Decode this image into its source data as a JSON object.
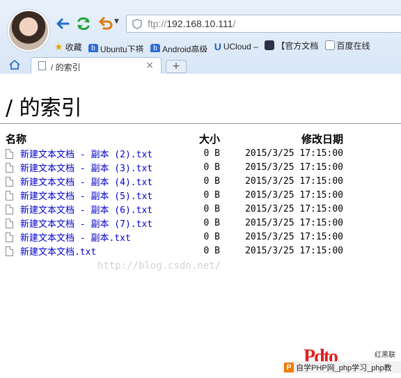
{
  "browser": {
    "url_prefix": "ftp://",
    "url_host": "192.168.10.111",
    "url_suffix": "/",
    "bookmarks": [
      {
        "label": "收藏",
        "icon": "star-icon"
      },
      {
        "label": "Ubuntu下搭",
        "icon": "ubuntu-icon"
      },
      {
        "label": "Android高级",
        "icon": "android-icon"
      },
      {
        "label": "UCloud –",
        "icon": "ucloud-icon"
      },
      {
        "label": "【官方文档",
        "icon": "site-icon"
      },
      {
        "label": "百度在线",
        "icon": "page-icon"
      }
    ],
    "tab_label": "/ 的索引",
    "tab_close": "×",
    "newtab_label": "+"
  },
  "page": {
    "heading": "/ 的索引",
    "columns": {
      "name": "名称",
      "size": "大小",
      "date": "修改日期"
    },
    "files": [
      {
        "name": "新建文本文档 - 副本 (2).txt",
        "size": "0 B",
        "date": "2015/3/25 17:15:00"
      },
      {
        "name": "新建文本文档 - 副本 (3).txt",
        "size": "0 B",
        "date": "2015/3/25 17:15:00"
      },
      {
        "name": "新建文本文档 - 副本 (4).txt",
        "size": "0 B",
        "date": "2015/3/25 17:15:00"
      },
      {
        "name": "新建文本文档 - 副本 (5).txt",
        "size": "0 B",
        "date": "2015/3/25 17:15:00"
      },
      {
        "name": "新建文本文档 - 副本 (6).txt",
        "size": "0 B",
        "date": "2015/3/25 17:15:00"
      },
      {
        "name": "新建文本文档 - 副本 (7).txt",
        "size": "0 B",
        "date": "2015/3/25 17:15:00"
      },
      {
        "name": "新建文本文档 - 副本.txt",
        "size": "0 B",
        "date": "2015/3/25 17:15:00"
      },
      {
        "name": "新建文本文档.txt",
        "size": "0 B",
        "date": "2015/3/25 17:15:00"
      }
    ],
    "watermark": "http://blog.csdn.net/"
  },
  "logo": {
    "glyph": "Pdto",
    "side_text": "红黑联盟",
    "bar_text": "自学PHP网_php学习_php教"
  }
}
